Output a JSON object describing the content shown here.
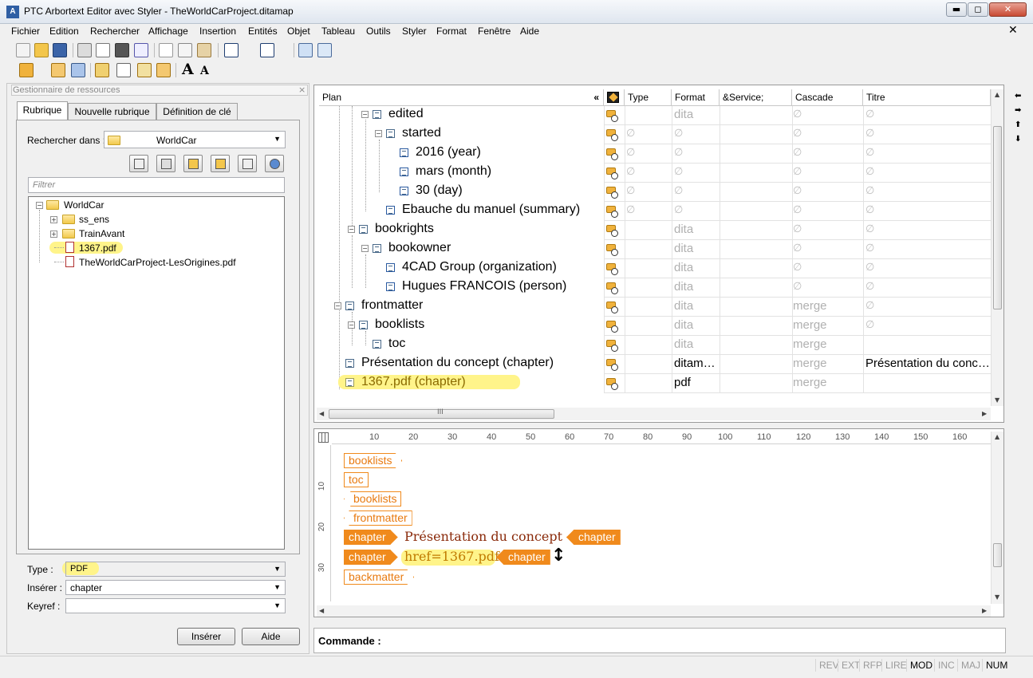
{
  "window": {
    "title": "PTC Arbortext Editor avec Styler - TheWorldCarProject.ditamap",
    "app_icon": "A"
  },
  "window_buttons": {
    "minimize": "▬",
    "maximize": "◻",
    "close": "✕"
  },
  "menu": [
    "Fichier",
    "Edition",
    "Rechercher",
    "Affichage",
    "Insertion",
    "Entités",
    "Objet",
    "Tableau",
    "Outils",
    "Styler",
    "Format",
    "Fenêtre",
    "Aide"
  ],
  "menu_close": "✕",
  "toolbar_text": {
    "font_up": "A",
    "font_down": "A"
  },
  "resource_manager": {
    "title": "Gestionnaire de ressources",
    "close": "×",
    "tabs": [
      "Rubrique",
      "Nouvelle rubrique",
      "Définition de clé"
    ],
    "search_in_label": "Rechercher dans :",
    "search_in_value": "WorldCar",
    "filter_placeholder": "Filtrer",
    "tree": {
      "root": "WorldCar",
      "children": [
        "ss_ens",
        "TrainAvant",
        "1367.pdf",
        "TheWorldCarProject-LesOrigines.pdf"
      ]
    },
    "type_label": "Type :",
    "type_value": "PDF",
    "insert_label": "Insérer :",
    "insert_value": "chapter",
    "keyref_label": "Keyref :",
    "keyref_value": "",
    "insert_button": "Insérer",
    "help_button": "Aide"
  },
  "map_table": {
    "columns": [
      "Plan",
      "Type",
      "Format",
      "&Service;",
      "Cascade",
      "Titre"
    ],
    "collapse": "«",
    "null_symbol": "∅",
    "rows": [
      {
        "plan": "edited",
        "format": "dita",
        "cascade": "∅",
        "titre": "∅"
      },
      {
        "plan": "started",
        "type": "∅",
        "format": "∅",
        "cascade": "∅",
        "titre": "∅"
      },
      {
        "plan": "2016 (year)",
        "type": "∅",
        "format": "∅",
        "cascade": "∅",
        "titre": "∅"
      },
      {
        "plan": "mars (month)",
        "type": "∅",
        "format": "∅",
        "cascade": "∅",
        "titre": "∅"
      },
      {
        "plan": "30 (day)",
        "type": "∅",
        "format": "∅",
        "cascade": "∅",
        "titre": "∅"
      },
      {
        "plan": "Ebauche du manuel (summary)",
        "type": "∅",
        "format": "∅",
        "cascade": "∅",
        "titre": "∅"
      },
      {
        "plan": "bookrights",
        "format": "dita",
        "cascade": "∅",
        "titre": "∅"
      },
      {
        "plan": "bookowner",
        "format": "dita",
        "cascade": "∅",
        "titre": "∅"
      },
      {
        "plan": "4CAD Group (organization)",
        "format": "dita",
        "cascade": "∅",
        "titre": "∅"
      },
      {
        "plan": "Hugues FRANCOIS (person)",
        "format": "dita",
        "cascade": "∅",
        "titre": "∅"
      },
      {
        "plan": "frontmatter",
        "format": "dita",
        "cascade": "merge",
        "titre": "∅"
      },
      {
        "plan": "booklists",
        "format": "dita",
        "cascade": "merge",
        "titre": "∅"
      },
      {
        "plan": "toc",
        "format": "dita",
        "cascade": "merge",
        "titre": ""
      },
      {
        "plan": "Présentation du concept (chapter)",
        "format": "ditam…",
        "cascade": "merge",
        "titre": "Présentation du conc…"
      },
      {
        "plan": "1367.pdf (chapter)",
        "format": "pdf",
        "cascade": "merge",
        "titre": ""
      }
    ],
    "hscroll_grip": "III"
  },
  "ruler": {
    "marks": [
      "10",
      "20",
      "30",
      "40",
      "50",
      "60",
      "70",
      "80",
      "90",
      "100",
      "110",
      "120",
      "130",
      "140",
      "150",
      "160"
    ],
    "vmarks": [
      "10",
      "20",
      "30"
    ]
  },
  "editor": {
    "tags": {
      "booklists_close": "booklists",
      "toc": "toc",
      "booklists_open": "booklists",
      "frontmatter": "frontmatter",
      "chapter1_open": "chapter",
      "chapter1_text": "Présentation du concept",
      "chapter1_close": "chapter",
      "chapter2_open": "chapter",
      "chapter2_text": "href=1367.pdf",
      "chapter2_close": "chapter",
      "backmatter": "backmatter"
    },
    "cursor": "↕"
  },
  "command": {
    "label": "Commande :"
  },
  "status": [
    "REV",
    "EXT",
    "RFP",
    "LIRE",
    "MOD",
    "INC",
    "MAJ",
    "NUM"
  ],
  "status_active": [
    "MOD",
    "NUM"
  ],
  "colors": {
    "tag_orange": "#f08a1c",
    "highlight": "#fff48a",
    "chapter_text": "#8a2a0a"
  }
}
